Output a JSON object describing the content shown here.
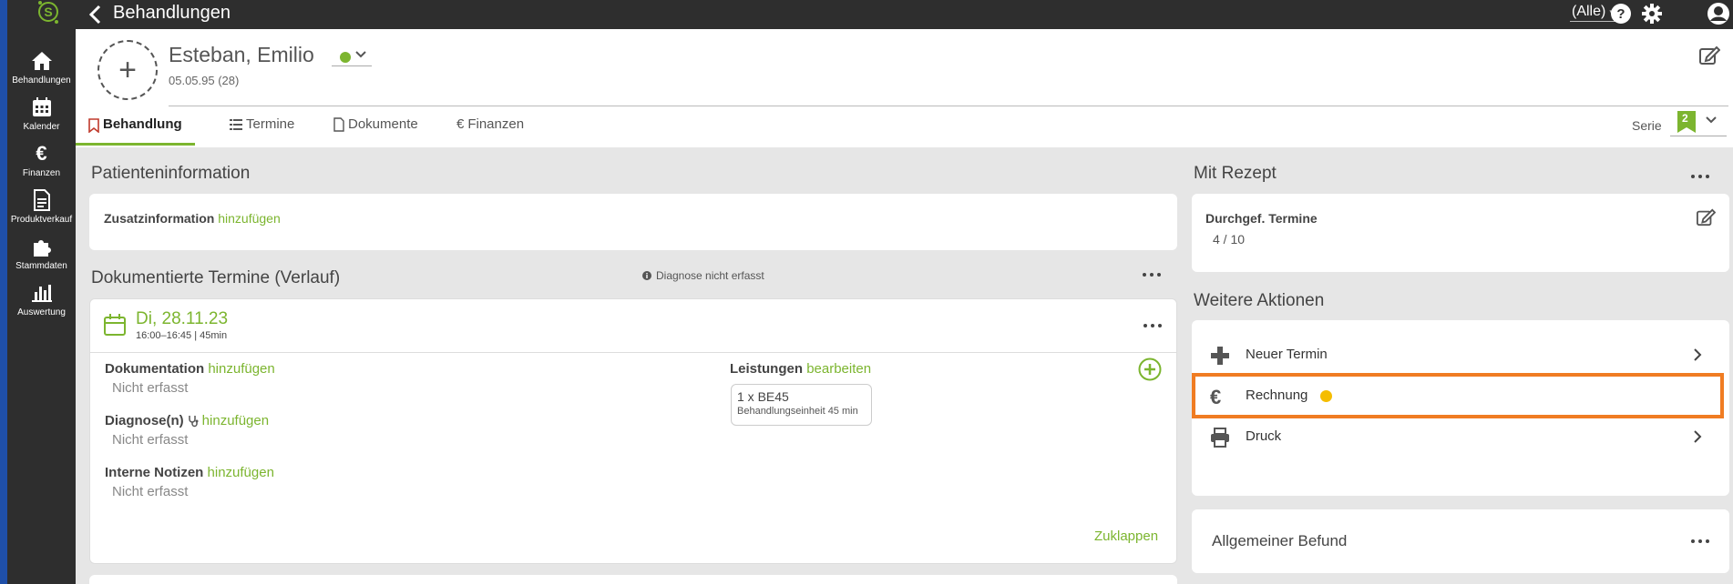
{
  "nav": [
    {
      "label": "Behandlungen",
      "icon": "home-icon"
    },
    {
      "label": "Kalender",
      "icon": "calendar-icon"
    },
    {
      "label": "Finanzen",
      "icon": "euro-icon"
    },
    {
      "label": "Produktverkauf",
      "icon": "document-icon"
    },
    {
      "label": "Stammdaten",
      "icon": "puzzle-icon"
    },
    {
      "label": "Auswertung",
      "icon": "bar-chart-icon"
    }
  ],
  "topbar": {
    "title": "Behandlungen",
    "filter": "(Alle)"
  },
  "patient": {
    "name": "Esteban, Emilio",
    "dob": "05.05.95 (28)",
    "status_color": "#7cb52f"
  },
  "tabs": [
    {
      "label": "Behandlung",
      "icon": "bookmark-icon",
      "active": true
    },
    {
      "label": "Termine",
      "icon": "list-icon",
      "active": false
    },
    {
      "label": "Dokumente",
      "icon": "file-icon",
      "active": false
    },
    {
      "label": "Finanzen",
      "icon": "euro-icon",
      "active": false
    }
  ],
  "serie": {
    "label": "Serie",
    "badge": "2"
  },
  "patientinfo": {
    "title": "Patienteninformation",
    "field_label": "Zusatzinformation",
    "field_link": "hinzufügen"
  },
  "verlauf": {
    "title": "Dokumentierte Termine (Verlauf)",
    "hint": "Diagnose nicht erfasst",
    "entry": {
      "date": "Di, 28.11.23",
      "time": "16:00–16:45 | 45min",
      "documentation": {
        "label": "Dokumentation",
        "link": "hinzufügen",
        "value": "Nicht erfasst"
      },
      "diagnose": {
        "label": "Diagnose(n)",
        "link": "hinzufügen",
        "value": "Nicht erfasst"
      },
      "notes": {
        "label": "Interne Notizen",
        "link": "hinzufügen",
        "value": "Nicht erfasst"
      },
      "leistungen": {
        "label": "Leistungen",
        "link": "bearbeiten",
        "item_code": "1 x BE45",
        "item_desc": "Behandlungseinheit 45 min"
      },
      "collapse": "Zuklappen"
    }
  },
  "rezept": {
    "title": "Mit Rezept",
    "label": "Durchgef. Termine",
    "value": "4 / 10"
  },
  "actions": {
    "title": "Weitere Aktionen",
    "items": [
      {
        "label": "Neuer Termin",
        "icon": "plus-icon"
      },
      {
        "label": "Rechnung",
        "icon": "euro-icon",
        "indicator_color": "#f5bd00",
        "highlight_color": "#f07c22"
      },
      {
        "label": "Druck",
        "icon": "printer-icon"
      }
    ]
  },
  "befund": {
    "title": "Allgemeiner Befund"
  },
  "colors": {
    "accent": "#7cb52f",
    "sidebar": "#2e2e2e",
    "edge": "#1f4fa8"
  }
}
